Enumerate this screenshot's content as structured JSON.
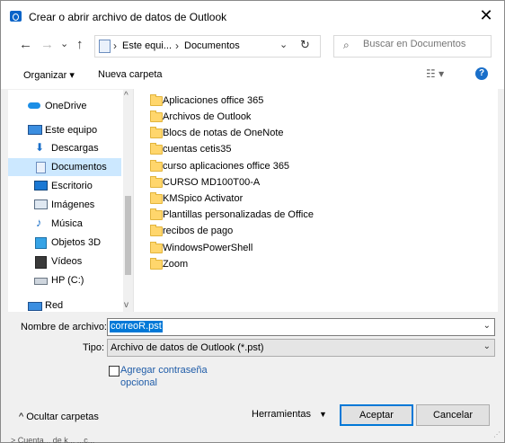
{
  "window": {
    "title": "Crear o abrir archivo de datos de Outlook",
    "close_glyph": "✕",
    "app_icon": "outlook-icon"
  },
  "nav": {
    "back_glyph": "←",
    "forward_glyph": "→",
    "recent_glyph": "⌄",
    "up_glyph": "↑",
    "breadcrumb": {
      "root": "Este equi...",
      "current": "Documentos",
      "sep": "›"
    },
    "dropdown_glyph": "⌄",
    "refresh_glyph": "↻"
  },
  "search": {
    "placeholder": "Buscar en Documentos",
    "icon_glyph": "⌕"
  },
  "toolbar": {
    "organize": "Organizar ▾",
    "new_folder": "Nueva carpeta",
    "view_glyph": "☷ ▾",
    "help_glyph": "?"
  },
  "sidebar": {
    "items": [
      {
        "label": "OneDrive",
        "icon": "cloud-icon"
      },
      {
        "label": "Este equipo",
        "icon": "computer-icon"
      },
      {
        "label": "Descargas",
        "icon": "download-icon"
      },
      {
        "label": "Documentos",
        "icon": "document-icon",
        "selected": true
      },
      {
        "label": "Escritorio",
        "icon": "desktop-icon"
      },
      {
        "label": "Imágenes",
        "icon": "pictures-icon"
      },
      {
        "label": "Música",
        "icon": "music-icon"
      },
      {
        "label": "Objetos 3D",
        "icon": "cube-icon"
      },
      {
        "label": "Vídeos",
        "icon": "video-icon"
      },
      {
        "label": "HP (C:)",
        "icon": "drive-icon"
      },
      {
        "label": "Red",
        "icon": "network-icon"
      }
    ],
    "scroll_up": "^",
    "scroll_down": "v"
  },
  "files": [
    "Aplicaciones office 365",
    "Archivos de Outlook",
    "Blocs de notas de OneNote",
    "cuentas cetis35",
    "curso aplicaciones office 365",
    "CURSO MD100T00-A",
    "KMSpico Activator",
    "Plantillas personalizadas de Office",
    "recibos de pago",
    "WindowsPowerShell",
    "Zoom"
  ],
  "form": {
    "filename_label": "Nombre de archivo:",
    "filename_value": "correoR.pst",
    "type_label": "Tipo:",
    "type_value": "Archivo de datos de Outlook (*.pst)",
    "dropdown_glyph": "⌄",
    "password_line1": "Agregar contraseña",
    "password_line2": "opcional",
    "hide_folders": "^  Ocultar carpetas",
    "tools": "Herramientas",
    "tools_arrow": "▼",
    "accept": "Aceptar",
    "cancel": "Cancelar"
  },
  "behind_text": "> Cuenta...  de k...  ...c..."
}
